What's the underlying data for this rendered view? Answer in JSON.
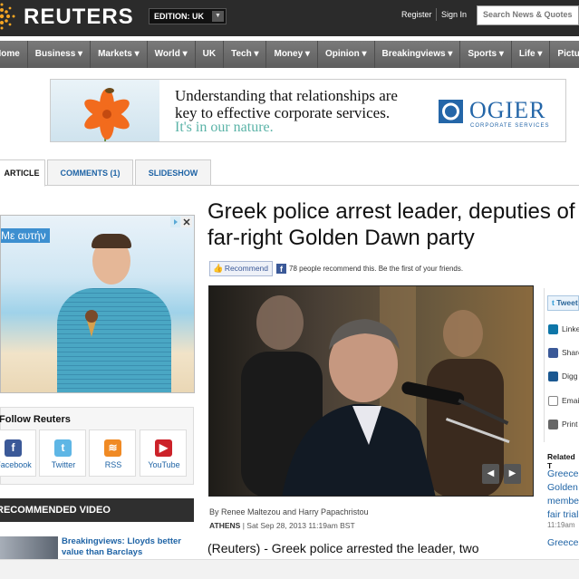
{
  "header": {
    "logo": "REUTERS",
    "edition_label": "EDITION:",
    "edition_value": "UK",
    "register": "Register",
    "sign_in": "Sign In",
    "search_placeholder": "Search News & Quotes"
  },
  "nav": {
    "items": [
      {
        "label": "Home"
      },
      {
        "label": "Business ▾"
      },
      {
        "label": "Markets ▾"
      },
      {
        "label": "World ▾"
      },
      {
        "label": "UK"
      },
      {
        "label": "Tech ▾"
      },
      {
        "label": "Money ▾"
      },
      {
        "label": "Opinion ▾"
      },
      {
        "label": "Breakingviews ▾"
      },
      {
        "label": "Sports ▾"
      },
      {
        "label": "Life ▾"
      },
      {
        "label": "Pictures ▾"
      }
    ]
  },
  "banner_ad": {
    "line1": "Understanding that relationships are",
    "line2": "key to effective corporate services.",
    "line3": "It's in our nature.",
    "brand": "OGIER",
    "brand_sub": "CORPORATE SERVICES"
  },
  "tabs": {
    "article": "ARTICLE",
    "comments": "COMMENTS (1)",
    "slideshow": "SLIDESHOW"
  },
  "side_ad": {
    "label": "Με αυτήν"
  },
  "follow": {
    "title": "Follow Reuters",
    "items": [
      {
        "label": "Facebook",
        "glyph": "f",
        "color": "#3b5998"
      },
      {
        "label": "Twitter",
        "glyph": "t",
        "color": "#5eb6e5"
      },
      {
        "label": "RSS",
        "glyph": "≋",
        "color": "#f08a24"
      },
      {
        "label": "YouTube",
        "glyph": "▶",
        "color": "#cc2229"
      }
    ]
  },
  "recommended": {
    "title": "RECOMMENDED VIDEO",
    "item_text": "Breakingviews: Lloyds better value than Barclays"
  },
  "article": {
    "headline_line1": "Greek police arrest leader, deputies of",
    "headline_line2": "far-right Golden Dawn party",
    "recommend_button": "Recommend",
    "recommend_count": "78 people recommend this. Be the first of your friends.",
    "byline": "By Renee Maltezou and Harry Papachristou",
    "dateline_city": "ATHENS",
    "dateline_date": "| Sat Sep 28, 2013 11:19am BST",
    "lede": "(Reuters) - Greek police arrested the leader, two"
  },
  "share": {
    "tweet": "Tweet",
    "items": [
      {
        "label": "Linkedin",
        "color": "#0e76a8"
      },
      {
        "label": "Share",
        "color": "#3b5998"
      },
      {
        "label": "Digg",
        "color": "#1b5891"
      },
      {
        "label": "Email",
        "color": "#888888"
      },
      {
        "label": "Print",
        "color": "#666666"
      }
    ],
    "related_title": "Related T",
    "related_links": [
      "Greece",
      "Golden",
      "member",
      "fair trial"
    ],
    "related_time": "11:19am",
    "related_link2": "Greece"
  }
}
